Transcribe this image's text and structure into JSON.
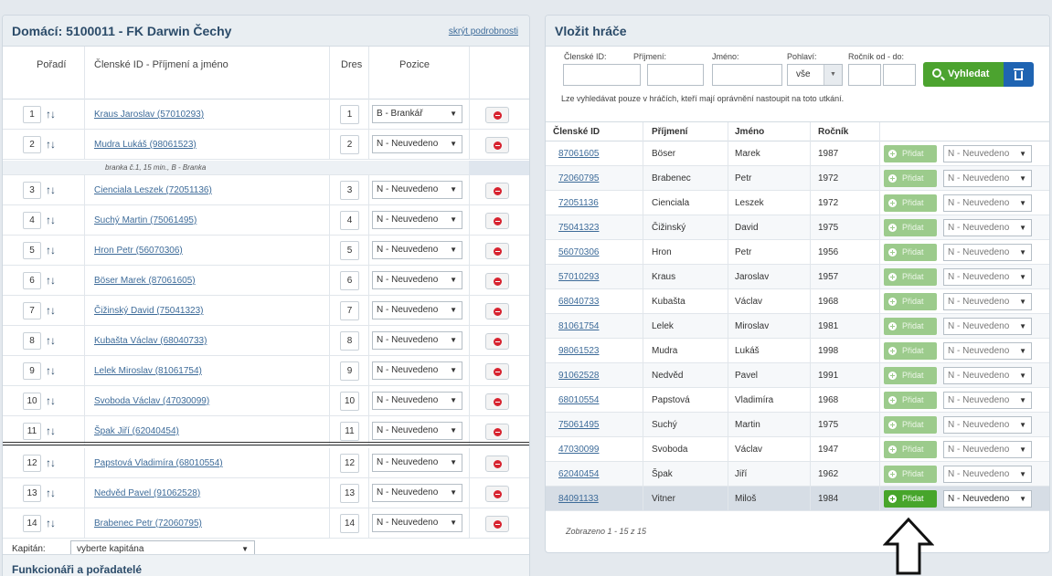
{
  "left": {
    "title": "Domácí: 5100011 - FK Darwin Čechy",
    "hide_link": "skrýt podrobnosti",
    "headers": {
      "order": "Pořadí",
      "member": "Členské ID - Příjmení a jméno",
      "jersey": "Dres",
      "position": "Pozice"
    },
    "note": "branka č.1, 15 min., B - Branka",
    "rows": [
      {
        "order": "1",
        "player": "Kraus Jaroslav (57010293)",
        "jersey": "1",
        "position": "B - Brankář"
      },
      {
        "order": "2",
        "player": "Mudra Lukáš (98061523)",
        "jersey": "2",
        "position": "N - Neuvedeno"
      },
      {
        "order": "3",
        "player": "Cienciala Leszek (72051136)",
        "jersey": "3",
        "position": "N - Neuvedeno"
      },
      {
        "order": "4",
        "player": "Suchý Martin (75061495)",
        "jersey": "4",
        "position": "N - Neuvedeno"
      },
      {
        "order": "5",
        "player": "Hron Petr (56070306)",
        "jersey": "5",
        "position": "N - Neuvedeno"
      },
      {
        "order": "6",
        "player": "Böser Marek (87061605)",
        "jersey": "6",
        "position": "N - Neuvedeno"
      },
      {
        "order": "7",
        "player": "Čižinský David (75041323)",
        "jersey": "7",
        "position": "N - Neuvedeno"
      },
      {
        "order": "8",
        "player": "Kubašta Václav (68040733)",
        "jersey": "8",
        "position": "N - Neuvedeno"
      },
      {
        "order": "9",
        "player": "Lelek Miroslav (81061754)",
        "jersey": "9",
        "position": "N - Neuvedeno"
      },
      {
        "order": "10",
        "player": "Svoboda Václav (47030099)",
        "jersey": "10",
        "position": "N - Neuvedeno"
      },
      {
        "order": "11",
        "player": "Špak Jiří (62040454)",
        "jersey": "11",
        "position": "N - Neuvedeno"
      },
      {
        "order": "12",
        "player": "Papstová Vladimíra (68010554)",
        "jersey": "12",
        "position": "N - Neuvedeno"
      },
      {
        "order": "13",
        "player": "Nedvěd Pavel (91062528)",
        "jersey": "13",
        "position": "N - Neuvedeno"
      },
      {
        "order": "14",
        "player": "Brabenec Petr (72060795)",
        "jersey": "14",
        "position": "N - Neuvedeno"
      }
    ],
    "captain_label": "Kapitán:",
    "captain_value": "vyberte kapitána",
    "functionaries": "Funkcionáři a pořadatelé"
  },
  "right": {
    "title": "Vložit hráče",
    "labels": {
      "member_id": "Členské ID:",
      "surname": "Příjmení:",
      "name": "Jméno:",
      "gender": "Pohlaví:",
      "year_range": "Ročník od - do:"
    },
    "gender_value": "vše",
    "search_label": "Vyhledat",
    "search_note": "Lze vyhledávat pouze v hráčích, kteří mají oprávnění nastoupit na toto utkání.",
    "headers": {
      "id": "Členské ID",
      "surname": "Příjmení",
      "name": "Jméno",
      "year": "Ročník"
    },
    "add_label": "Přidat",
    "rows": [
      {
        "id": "87061605",
        "surname": "Böser",
        "name": "Marek",
        "year": "1987",
        "position": "N - Neuvedeno"
      },
      {
        "id": "72060795",
        "surname": "Brabenec",
        "name": "Petr",
        "year": "1972",
        "position": "N - Neuvedeno"
      },
      {
        "id": "72051136",
        "surname": "Cienciala",
        "name": "Leszek",
        "year": "1972",
        "position": "N - Neuvedeno"
      },
      {
        "id": "75041323",
        "surname": "Čižinský",
        "name": "David",
        "year": "1975",
        "position": "N - Neuvedeno"
      },
      {
        "id": "56070306",
        "surname": "Hron",
        "name": "Petr",
        "year": "1956",
        "position": "N - Neuvedeno"
      },
      {
        "id": "57010293",
        "surname": "Kraus",
        "name": "Jaroslav",
        "year": "1957",
        "position": "N - Neuvedeno"
      },
      {
        "id": "68040733",
        "surname": "Kubašta",
        "name": "Václav",
        "year": "1968",
        "position": "N - Neuvedeno"
      },
      {
        "id": "81061754",
        "surname": "Lelek",
        "name": "Miroslav",
        "year": "1981",
        "position": "N - Neuvedeno"
      },
      {
        "id": "98061523",
        "surname": "Mudra",
        "name": "Lukáš",
        "year": "1998",
        "position": "N - Neuvedeno"
      },
      {
        "id": "91062528",
        "surname": "Nedvěd",
        "name": "Pavel",
        "year": "1991",
        "position": "N - Neuvedeno"
      },
      {
        "id": "68010554",
        "surname": "Papstová",
        "name": "Vladimíra",
        "year": "1968",
        "position": "N - Neuvedeno"
      },
      {
        "id": "75061495",
        "surname": "Suchý",
        "name": "Martin",
        "year": "1975",
        "position": "N - Neuvedeno"
      },
      {
        "id": "47030099",
        "surname": "Svoboda",
        "name": "Václav",
        "year": "1947",
        "position": "N - Neuvedeno"
      },
      {
        "id": "62040454",
        "surname": "Špak",
        "name": "Jiří",
        "year": "1962",
        "position": "N - Neuvedeno"
      },
      {
        "id": "84091133",
        "surname": "Vitner",
        "name": "Miloš",
        "year": "1984",
        "position": "N - Neuvedeno"
      }
    ],
    "footer": "Zobrazeno 1 - 15 z 15"
  }
}
